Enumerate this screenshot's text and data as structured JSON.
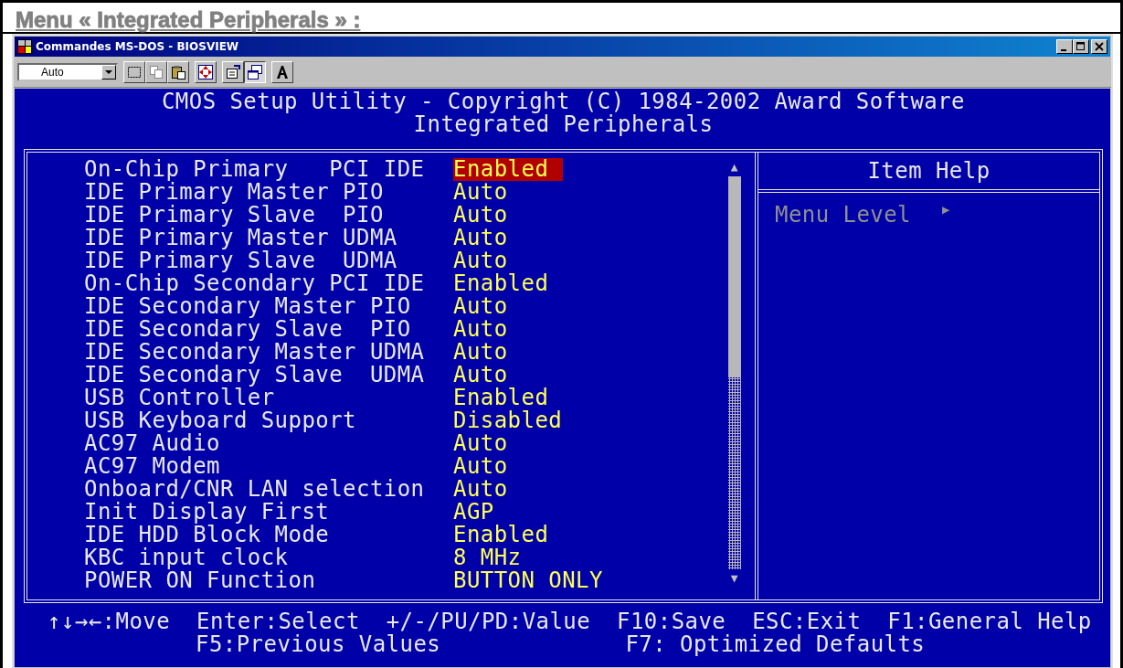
{
  "heading": "Menu « Integrated Peripherals » :",
  "window": {
    "title": "Commandes MS-DOS - BIOSVIEW"
  },
  "toolbar": {
    "font_size": "Auto"
  },
  "bios": {
    "title": "CMOS Setup Utility - Copyright (C) 1984-2002 Award Software",
    "subtitle": "Integrated Peripherals",
    "items": [
      {
        "label": "On-Chip Primary   PCI IDE",
        "value": "Enabled",
        "selected": true
      },
      {
        "label": "IDE Primary Master PIO",
        "value": "Auto",
        "selected": false
      },
      {
        "label": "IDE Primary Slave  PIO",
        "value": "Auto",
        "selected": false
      },
      {
        "label": "IDE Primary Master UDMA",
        "value": "Auto",
        "selected": false
      },
      {
        "label": "IDE Primary Slave  UDMA",
        "value": "Auto",
        "selected": false
      },
      {
        "label": "On-Chip Secondary PCI IDE",
        "value": "Enabled",
        "selected": false
      },
      {
        "label": "IDE Secondary Master PIO",
        "value": "Auto",
        "selected": false
      },
      {
        "label": "IDE Secondary Slave  PIO",
        "value": "Auto",
        "selected": false
      },
      {
        "label": "IDE Secondary Master UDMA",
        "value": "Auto",
        "selected": false
      },
      {
        "label": "IDE Secondary Slave  UDMA",
        "value": "Auto",
        "selected": false
      },
      {
        "label": "USB Controller",
        "value": "Enabled",
        "selected": false
      },
      {
        "label": "USB Keyboard Support",
        "value": "Disabled",
        "selected": false
      },
      {
        "label": "AC97 Audio",
        "value": "Auto",
        "selected": false
      },
      {
        "label": "AC97 Modem",
        "value": "Auto",
        "selected": false
      },
      {
        "label": "Onboard/CNR LAN selection",
        "value": "Auto",
        "selected": false
      },
      {
        "label": "Init Display First",
        "value": "AGP",
        "selected": false
      },
      {
        "label": "IDE HDD Block Mode",
        "value": "Enabled",
        "selected": false
      },
      {
        "label": "KBC input clock",
        "value": "8 MHz",
        "selected": false
      },
      {
        "label": "POWER ON Function",
        "value": "BUTTON ONLY",
        "selected": false
      }
    ],
    "help": {
      "title": "Item Help",
      "menu_level": "Menu Level",
      "marker": "▶"
    },
    "scroll_arrows": {
      "up": "▲",
      "down": "▼"
    },
    "footer": [
      [
        "↑↓→←:Move",
        "Enter:Select",
        "+/-/PU/PD:Value",
        "F10:Save",
        "ESC:Exit",
        "F1:General Help"
      ],
      [
        "F5:Previous Values",
        "F7: Optimized Defaults"
      ]
    ]
  }
}
